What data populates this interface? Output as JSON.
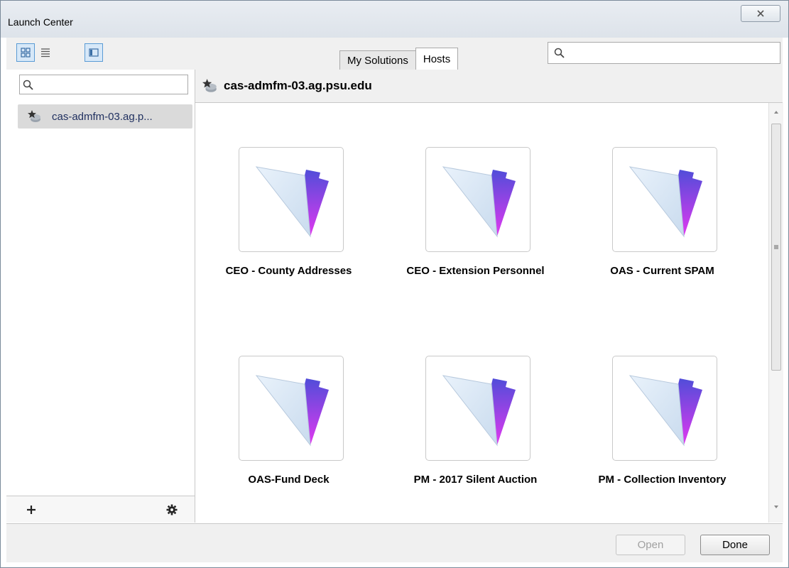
{
  "window": {
    "title": "Launch Center"
  },
  "toolbar": {
    "tabs": [
      {
        "label": "My Solutions",
        "active": false
      },
      {
        "label": "Hosts",
        "active": true
      }
    ],
    "search_placeholder": ""
  },
  "sidebar": {
    "search_placeholder": "",
    "hosts": [
      {
        "label": "cas-admfm-03.ag.p...",
        "selected": true
      }
    ]
  },
  "main": {
    "host_title": "cas-admfm-03.ag.psu.edu",
    "files": [
      {
        "name": "CEO - County Addresses"
      },
      {
        "name": "CEO - Extension Personnel"
      },
      {
        "name": "OAS - Current SPAM"
      },
      {
        "name": "OAS-Fund Deck"
      },
      {
        "name": "PM - 2017 Silent Auction"
      },
      {
        "name": "PM - Collection Inventory"
      }
    ]
  },
  "footer": {
    "open_label": "Open",
    "done_label": "Done"
  },
  "colors": {
    "folder_front": "#e3eef8",
    "folder_accent": "#7b2ff7",
    "folder_tab": "#4a4ed8"
  }
}
